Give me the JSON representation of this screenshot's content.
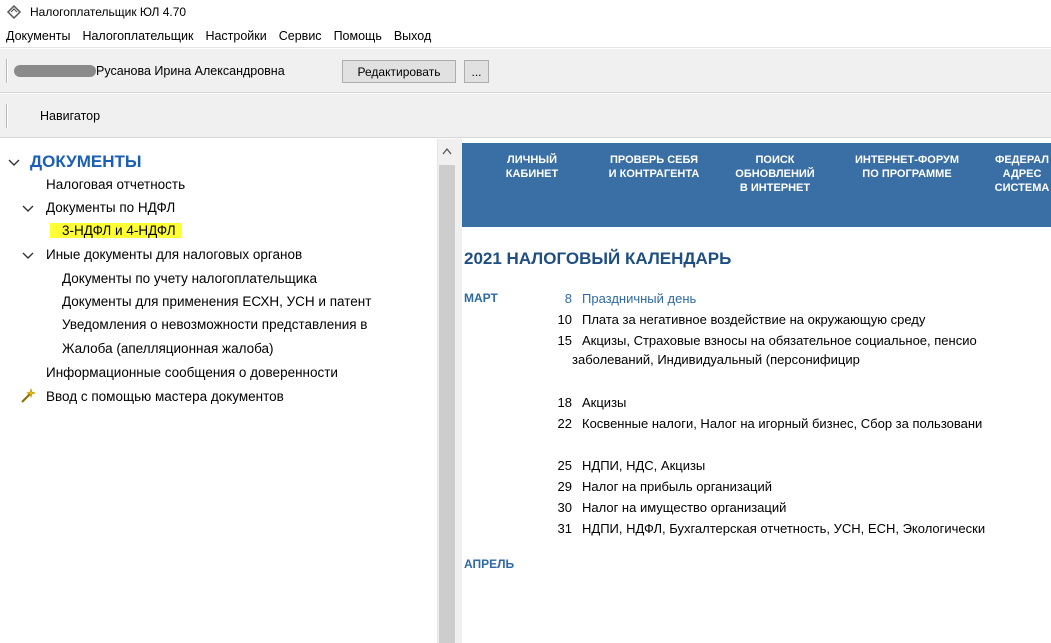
{
  "window": {
    "title": "Налогоплательщик ЮЛ 4.70"
  },
  "menu": [
    "Документы",
    "Налогоплательщик",
    "Настройки",
    "Сервис",
    "Помощь",
    "Выход"
  ],
  "user": {
    "name": "Русанова Ирина Александровна",
    "edit_label": "Редактировать",
    "more_label": "..."
  },
  "navigator": {
    "label": "Навигатор"
  },
  "tree": {
    "root": "ДОКУМЕНТЫ",
    "items": [
      "Налоговая отчетность",
      "Документы по НДФЛ",
      "3-НДФЛ и 4-НДФЛ",
      "Иные документы для налоговых органов",
      "Документы по учету налогоплательщика",
      "Документы для применения ЕСХН, УСН и патент",
      "Уведомления о невозможности представления в",
      "Жалоба (апелляционная жалоба)",
      "Информационные сообщения о доверенности",
      "Ввод с помощью мастера документов"
    ]
  },
  "banner": {
    "links": [
      "ЛИЧНЫЙ\nКАБИНЕТ",
      "ПРОВЕРЬ СЕБЯ\nИ КОНТРАГЕНТА",
      "ПОИСК\nОБНОВЛЕНИЙ\nВ ИНТЕРНЕТ",
      "ИНТЕРНЕТ-ФОРУМ\nПО ПРОГРАММЕ",
      "ФЕДЕРАЛ\nАДРЕС\nСИСТЕМА"
    ]
  },
  "calendar": {
    "title": "2021  НАЛОГОВЫЙ КАЛЕНДАРЬ",
    "months": [
      "МАРТ",
      "АПРЕЛЬ"
    ],
    "events": [
      {
        "day": "8",
        "text": "Праздничный день"
      },
      {
        "day": "10",
        "text": "Плата за негативное воздействие на окружающую среду"
      },
      {
        "day": "15",
        "text": "Акцизы, Страховые взносы на обязательное социальное, пенсио"
      },
      {
        "day": "",
        "text": "заболеваний, Индивидуальный (персонифицир"
      },
      {
        "day": "18",
        "text": "Акцизы"
      },
      {
        "day": "22",
        "text": "Косвенные налоги, Налог на игорный бизнес, Сбор за пользовани"
      },
      {
        "day": "25",
        "text": "НДПИ, НДС, Акцизы"
      },
      {
        "day": "29",
        "text": "Налог на прибыль организаций"
      },
      {
        "day": "30",
        "text": "Налог на имущество организаций"
      },
      {
        "day": "31",
        "text": "НДПИ, НДФЛ, Бухгалтерская отчетность, УСН, ЕСН, Экологически"
      }
    ]
  },
  "colors": {
    "banner": "#3a6fa5",
    "accent": "#1a5fb4",
    "highlight": "#ffff33"
  }
}
